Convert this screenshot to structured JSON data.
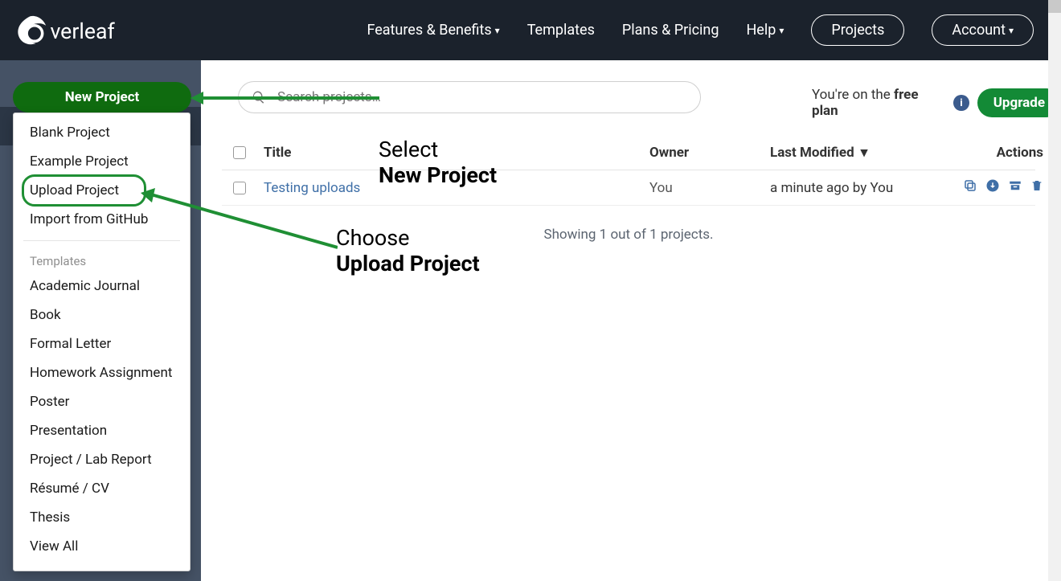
{
  "nav": {
    "features": "Features & Benefits",
    "templates": "Templates",
    "plans": "Plans & Pricing",
    "help": "Help",
    "projects": "Projects",
    "account": "Account"
  },
  "sidebar": {
    "new_project": "New Project",
    "items": [
      "Blank Project",
      "Example Project",
      "Upload Project",
      "Import from GitHub"
    ],
    "templates_header": "Templates",
    "template_items": [
      "Academic Journal",
      "Book",
      "Formal Letter",
      "Homework Assignment",
      "Poster",
      "Presentation",
      "Project / Lab Report",
      "Résumé / CV",
      "Thesis",
      "View All"
    ]
  },
  "search": {
    "placeholder": "Search projects…"
  },
  "plan": {
    "prefix": "You're on the ",
    "plan_name": "free plan",
    "upgrade": "Upgrade",
    "info_glyph": "i"
  },
  "table": {
    "headers": {
      "title": "Title",
      "owner": "Owner",
      "last_modified": "Last Modified",
      "actions": "Actions"
    },
    "rows": [
      {
        "title": "Testing uploads",
        "owner": "You",
        "modified": "a minute ago by You"
      }
    ],
    "showing": "Showing 1 out of 1 projects."
  },
  "annotations": {
    "a1_line1": "Select",
    "a1_line2": "New Project",
    "a2_line1": "Choose",
    "a2_line2": "Upload Project"
  }
}
